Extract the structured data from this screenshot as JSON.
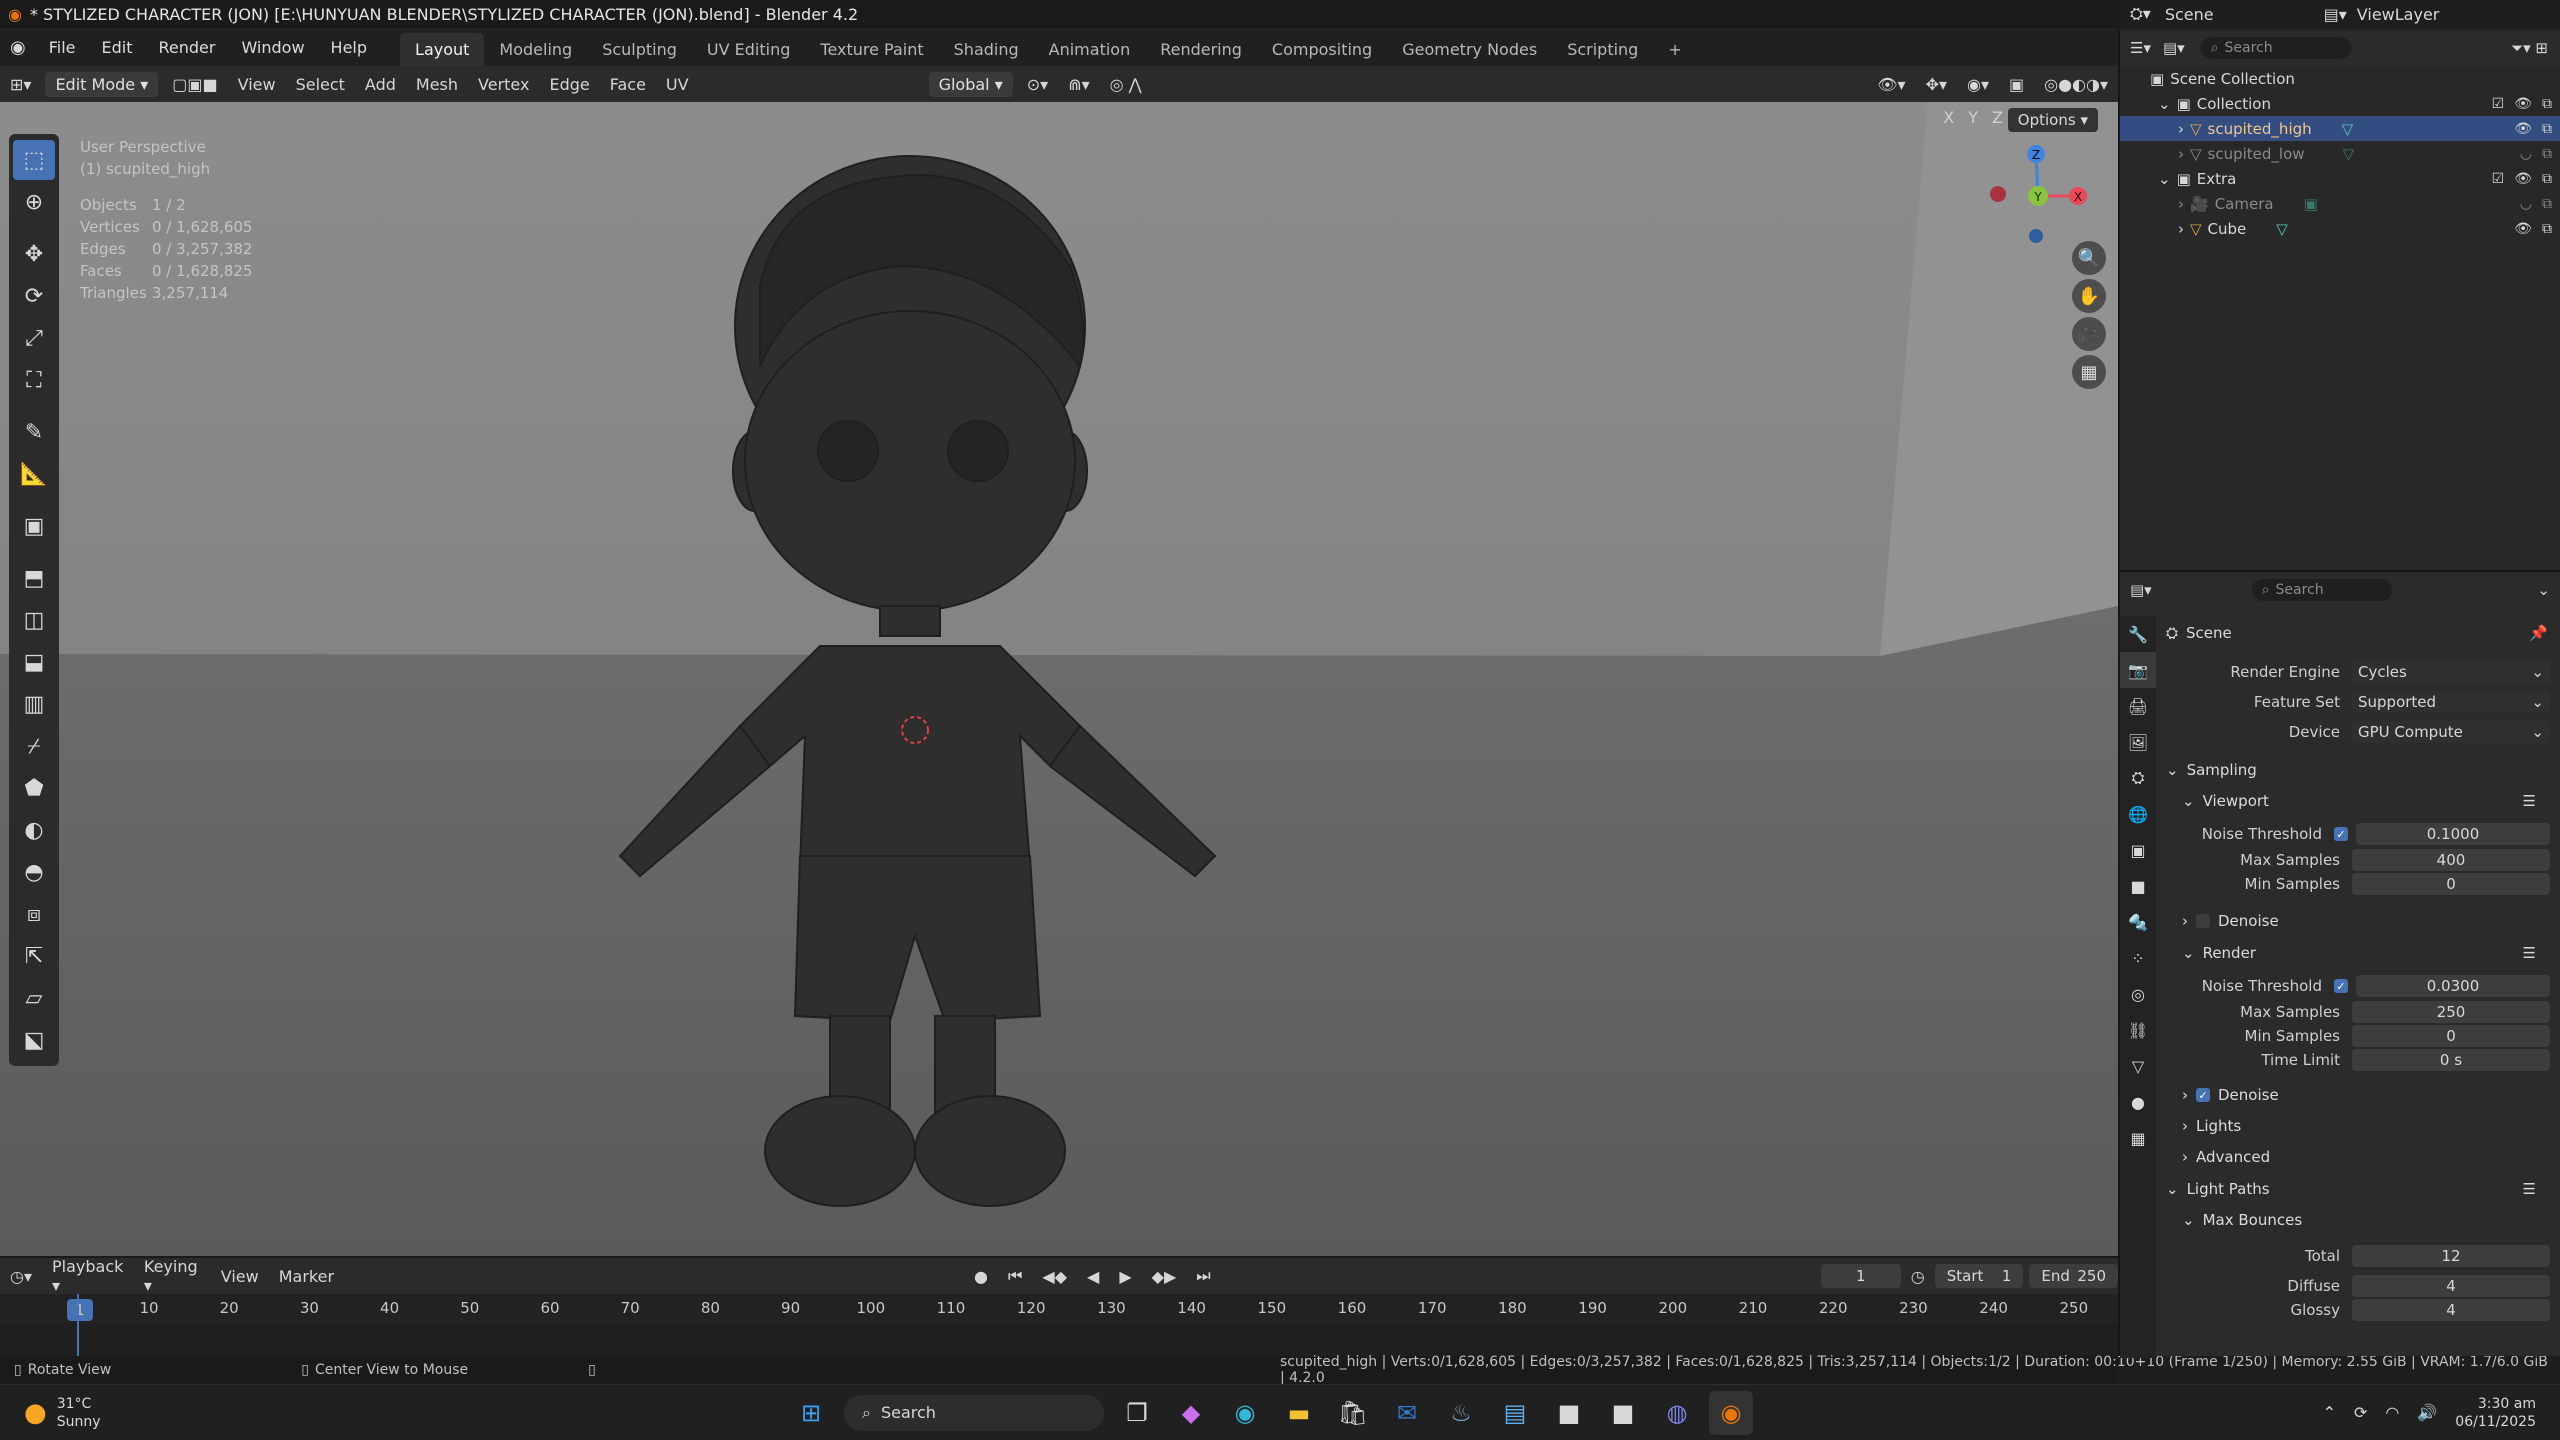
{
  "titlebar": {
    "title": "* STYLIZED CHARACTER (JON) [E:\\HUNYUAN BLENDER\\STYLIZED CHARACTER (JON).blend] - Blender 4.2"
  },
  "menu": {
    "items": [
      "File",
      "Edit",
      "Render",
      "Window",
      "Help"
    ]
  },
  "workspaces": [
    "Layout",
    "Modeling",
    "Sculpting",
    "UV Editing",
    "Texture Paint",
    "Shading",
    "Animation",
    "Rendering",
    "Compositing",
    "Geometry Nodes",
    "Scripting",
    "+"
  ],
  "scene_selector": {
    "label": "Scene",
    "view_layer": "ViewLayer"
  },
  "viewport": {
    "mode": "Edit Mode",
    "menus": [
      "View",
      "Select",
      "Add",
      "Mesh",
      "Vertex",
      "Edge",
      "Face",
      "UV"
    ],
    "orientation": "Global",
    "options_label": "Options",
    "axis_labels": [
      "X",
      "Y",
      "Z"
    ],
    "overlay_title": "User Perspective",
    "overlay_object": "(1) scupited_high",
    "stats": [
      {
        "label": "Objects",
        "value": "1 / 2"
      },
      {
        "label": "Vertices",
        "value": "0 / 1,628,605"
      },
      {
        "label": "Edges",
        "value": "0 / 3,257,382"
      },
      {
        "label": "Faces",
        "value": "0 / 1,628,825"
      },
      {
        "label": "Triangles",
        "value": "3,257,114"
      }
    ],
    "gizmo": {
      "x": "X",
      "y": "Y",
      "z": "Z",
      "colors": {
        "x": "#e84a5a",
        "y": "#8bc53f",
        "z": "#3f85e0"
      }
    }
  },
  "timeline": {
    "menus": [
      "Playback",
      "Keying",
      "View",
      "Marker"
    ],
    "current_frame": "1",
    "start_label": "Start",
    "start": "1",
    "end_label": "End",
    "end": "250",
    "ruler": [
      "1",
      "10",
      "20",
      "30",
      "40",
      "50",
      "60",
      "70",
      "80",
      "90",
      "100",
      "110",
      "120",
      "130",
      "140",
      "150",
      "160",
      "170",
      "180",
      "190",
      "200",
      "210",
      "220",
      "230",
      "240",
      "250"
    ]
  },
  "status": {
    "left1": "Rotate View",
    "left2": "Center View to Mouse",
    "right": "scupited_high | Verts:0/1,628,605 | Edges:0/3,257,382 | Faces:0/1,628,825 | Tris:3,257,114 | Objects:1/2 | Duration: 00:10+10 (Frame 1/250) | Memory: 2.55 GiB | VRAM: 1.7/6.0 GiB | 4.2.0"
  },
  "outliner": {
    "search_placeholder": "Search",
    "root": "Scene Collection",
    "items": [
      {
        "name": "Collection",
        "level": 1
      },
      {
        "name": "scupited_high",
        "level": 2,
        "selected": true
      },
      {
        "name": "scupited_low",
        "level": 2
      },
      {
        "name": "Extra",
        "level": 1
      },
      {
        "name": "Camera",
        "level": 2
      },
      {
        "name": "Cube",
        "level": 2
      }
    ]
  },
  "properties": {
    "search_placeholder": "Search",
    "context": "Scene",
    "render_engine_label": "Render Engine",
    "render_engine": "Cycles",
    "feature_set_label": "Feature Set",
    "feature_set": "Supported",
    "device_label": "Device",
    "device": "GPU Compute",
    "sampling": "Sampling",
    "viewport": "Viewport",
    "noise_threshold_label": "Noise Threshold",
    "vp_noise": "0.1000",
    "max_samples_label": "Max Samples",
    "vp_max": "400",
    "min_samples_label": "Min Samples",
    "vp_min": "0",
    "denoise": "Denoise",
    "render": "Render",
    "r_noise": "0.0300",
    "r_max": "250",
    "r_min": "0",
    "time_limit_label": "Time Limit",
    "time_limit": "0 s",
    "lights": "Lights",
    "advanced": "Advanced",
    "light_paths": "Light Paths",
    "max_bounces": "Max Bounces",
    "total_label": "Total",
    "total": "12",
    "diffuse_label": "Diffuse",
    "diffuse": "4",
    "glossy_label": "Glossy",
    "glossy": "4"
  },
  "taskbar": {
    "weather_temp": "31°C",
    "weather_desc": "Sunny",
    "search": "Search",
    "time": "3:30 am",
    "date": "06/11/2025"
  }
}
